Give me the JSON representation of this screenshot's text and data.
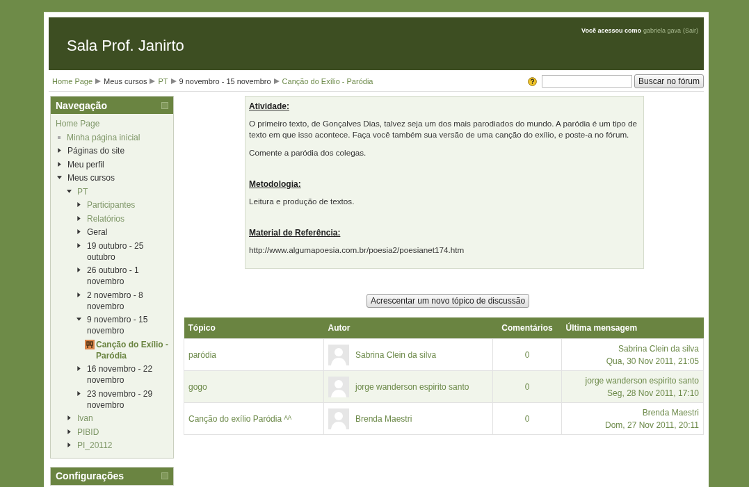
{
  "header": {
    "title": "Sala Prof. Janirto",
    "login_prefix": "Você acessou como",
    "user": "gabriela gava",
    "logout": "(Sair)"
  },
  "breadcrumb": [
    {
      "label": "Home Page",
      "link": true
    },
    {
      "label": "Meus cursos",
      "link": false
    },
    {
      "label": "PT",
      "link": true
    },
    {
      "label": "9 novembro - 15 novembro",
      "link": false
    },
    {
      "label": "Canção do Exílio - Paródia",
      "link": true
    }
  ],
  "search": {
    "button": "Buscar no fórum"
  },
  "navigation": {
    "title": "Navegação",
    "items": [
      {
        "label": "Home Page",
        "kind": "plain",
        "link": true
      },
      {
        "label": "Minha página inicial",
        "kind": "bullet",
        "link": true
      },
      {
        "label": "Páginas do site",
        "kind": "branch",
        "link": false,
        "expanded": false
      },
      {
        "label": "Meu perfil",
        "kind": "branch",
        "link": false,
        "expanded": false
      },
      {
        "label": "Meus cursos",
        "kind": "branch",
        "link": false,
        "expanded": true,
        "children": [
          {
            "label": "PT",
            "kind": "branch",
            "link": true,
            "expanded": true,
            "children": [
              {
                "label": "Participantes",
                "kind": "branch",
                "link": true,
                "expanded": false
              },
              {
                "label": "Relatórios",
                "kind": "branch",
                "link": true,
                "expanded": false
              },
              {
                "label": "Geral",
                "kind": "branch",
                "link": false,
                "expanded": false
              },
              {
                "label": "19 outubro - 25 outubro",
                "kind": "branch",
                "link": false,
                "expanded": false
              },
              {
                "label": "26 outubro - 1 novembro",
                "kind": "branch",
                "link": false,
                "expanded": false
              },
              {
                "label": "2 novembro - 8 novembro",
                "kind": "branch",
                "link": false,
                "expanded": false
              },
              {
                "label": "9 novembro - 15 novembro",
                "kind": "branch",
                "link": false,
                "expanded": true,
                "children": [
                  {
                    "label": "Canção do Exílio - Paródia",
                    "kind": "activity",
                    "link": true
                  }
                ]
              },
              {
                "label": "16 novembro - 22 novembro",
                "kind": "branch",
                "link": false,
                "expanded": false
              },
              {
                "label": "23 novembro - 29 novembro",
                "kind": "branch",
                "link": false,
                "expanded": false
              }
            ]
          },
          {
            "label": "Ivan",
            "kind": "branch",
            "link": true,
            "expanded": false
          },
          {
            "label": "PIBID",
            "kind": "branch",
            "link": true,
            "expanded": false
          },
          {
            "label": "PI_20112",
            "kind": "branch",
            "link": true,
            "expanded": false
          }
        ]
      }
    ]
  },
  "settings": {
    "title": "Configurações"
  },
  "intro": [
    {
      "kind": "heading",
      "text": "Atividade:"
    },
    {
      "kind": "paragraph",
      "text": "O primeiro texto, de Gonçalves Dias, talvez seja um dos mais parodiados do mundo. A paródia é um tipo de texto em que isso acontece. Faça você também sua versão de uma canção do exílio, e poste-a no fórum."
    },
    {
      "kind": "paragraph",
      "text": "Comente a paródia dos colegas."
    },
    {
      "kind": "heading",
      "text": "Metodologia:"
    },
    {
      "kind": "paragraph",
      "text": "Leitura e produção de textos."
    },
    {
      "kind": "heading",
      "text": "Material de Referência:"
    },
    {
      "kind": "paragraph",
      "text": "http://www.algumapoesia.com.br/poesia2/poesianet174.htm"
    }
  ],
  "add_button": "Acrescentar um novo tópico de discussão",
  "table": {
    "columns": [
      "Tópico",
      "Autor",
      "Comentários",
      "Última mensagem"
    ],
    "rows": [
      {
        "topic": "paródia",
        "author": "Sabrina Clein da silva",
        "comments": "0",
        "last_author": "Sabrina Clein da silva",
        "last_date": "Qua, 30 Nov 2011, 21:05"
      },
      {
        "topic": "gogo",
        "author": "jorge wanderson espirito santo",
        "comments": "0",
        "last_author": "jorge wanderson espirito santo",
        "last_date": "Seg, 28 Nov 2011, 17:10"
      },
      {
        "topic": "Canção do exílio Paródia ᴬᴬ",
        "author": "Brenda Maestri",
        "comments": "0",
        "last_author": "Brenda Maestri",
        "last_date": "Dom, 27 Nov 2011, 20:11"
      }
    ]
  }
}
